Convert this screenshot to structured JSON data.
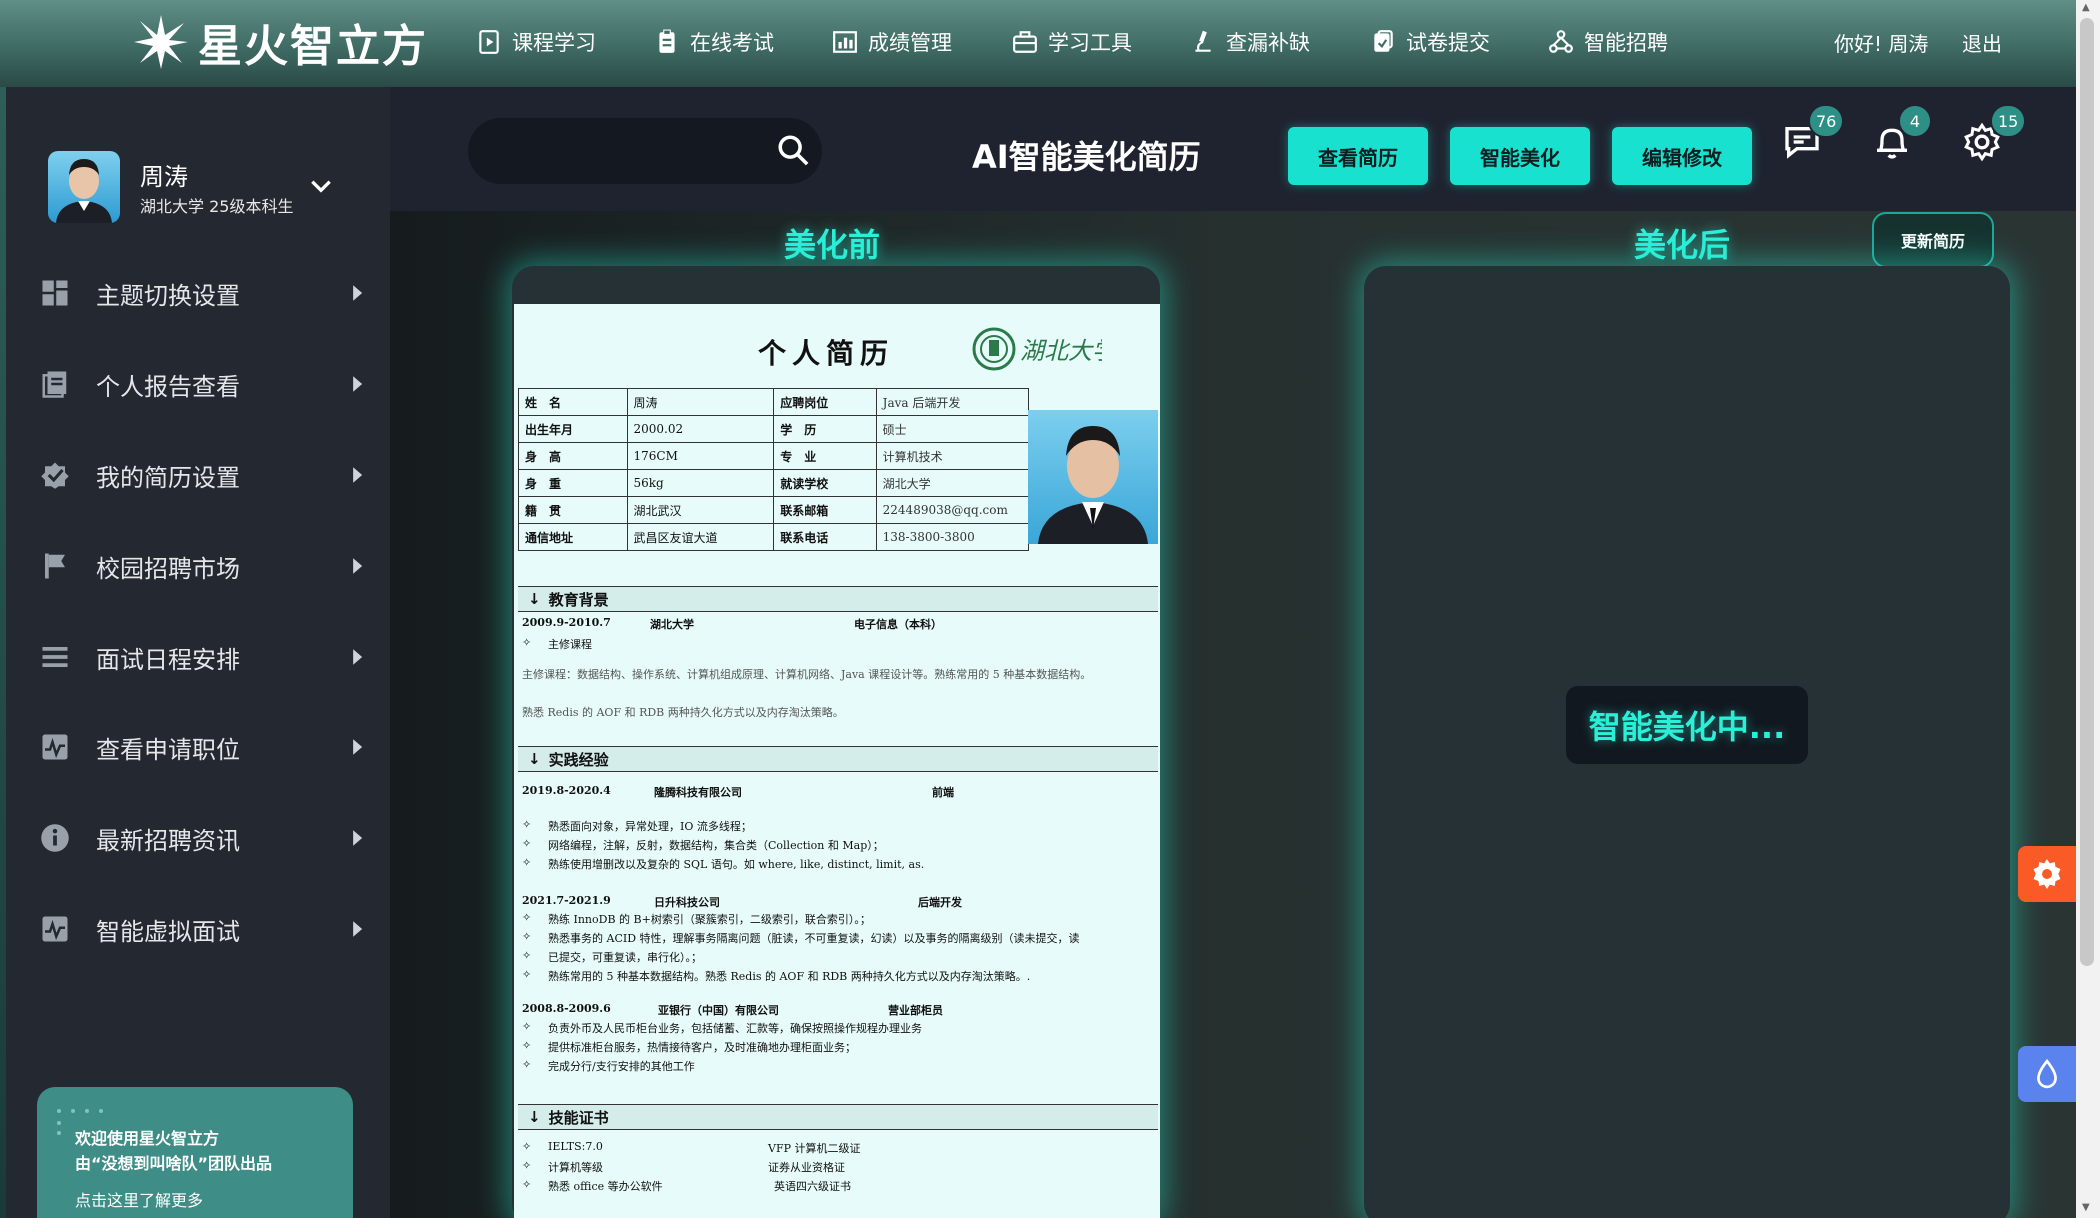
{
  "app": {
    "logo_text": "星火智立方"
  },
  "topnav": [
    {
      "label": "课程学习",
      "icon": "play-document-icon"
    },
    {
      "label": "在线考试",
      "icon": "clipboard-icon"
    },
    {
      "label": "成绩管理",
      "icon": "bar-chart-icon"
    },
    {
      "label": "学习工具",
      "icon": "toolbox-icon"
    },
    {
      "label": "查漏补缺",
      "icon": "microscope-icon"
    },
    {
      "label": "试卷提交",
      "icon": "submit-paper-icon"
    },
    {
      "label": "智能招聘",
      "icon": "network-icon"
    }
  ],
  "user_header": {
    "greeting": "你好! 周涛",
    "logout": "退出"
  },
  "profile": {
    "name": "周涛",
    "info": "湖北大学 25级本科生"
  },
  "sidebar": [
    {
      "label": "主题切换设置",
      "icon": "grid-icon"
    },
    {
      "label": "个人报告查看",
      "icon": "report-icon"
    },
    {
      "label": "我的简历设置",
      "icon": "check-badge-icon"
    },
    {
      "label": "校园招聘市场",
      "icon": "flag-icon"
    },
    {
      "label": "面试日程安排",
      "icon": "list-icon"
    },
    {
      "label": "查看申请职位",
      "icon": "pulse-icon"
    },
    {
      "label": "最新招聘资讯",
      "icon": "info-icon"
    },
    {
      "label": "智能虚拟面试",
      "icon": "pulse-icon"
    }
  ],
  "promo": {
    "line1": "欢迎使用星火智立方",
    "line2": "由“没想到叫啥队”团队出品",
    "line3": "点击这里了解更多"
  },
  "header": {
    "search_placeholder": "",
    "title": "AI智能美化简历",
    "buttons": {
      "view": "查看简历",
      "beautify": "智能美化",
      "edit": "编辑修改"
    },
    "badges": {
      "messages": "76",
      "notifications": "4",
      "settings": "15"
    }
  },
  "main": {
    "before_title": "美化前",
    "after_title": "美化后",
    "update_button": "更新简历",
    "loading_text": "智能美化中..."
  },
  "resume": {
    "title": "个人简历",
    "school_logo_text": "湖北大学",
    "info_rows": [
      {
        "k1": "姓　名",
        "v1": "周涛",
        "k2": "应聘岗位",
        "v2": "Java 后端开发"
      },
      {
        "k1": "出生年月",
        "v1": "2000.02",
        "k2": "学　历",
        "v2": "硕士"
      },
      {
        "k1": "身　高",
        "v1": "176CM",
        "k2": "专　业",
        "v2": "计算机技术"
      },
      {
        "k1": "身　重",
        "v1": "56kg",
        "k2": "就读学校",
        "v2": "湖北大学"
      },
      {
        "k1": "籍　贯",
        "v1": "湖北武汉",
        "k2": "联系邮箱",
        "v2": "224489038@qq.com"
      },
      {
        "k1": "通信地址",
        "v1": "武昌区友谊大道",
        "k2": "联系电话",
        "v2": "138-3800-3800"
      }
    ],
    "education": {
      "heading": "教育背景",
      "period": "2009.9-2010.7",
      "school": "湖北大学",
      "major": "电子信息（本科）",
      "courses_label": "主修课程",
      "courses": "主修课程：数据结构、操作系统、计算机组成原理、计算机网络、Java 课程设计等。熟练常用的 5 种基本数据结构。",
      "redis": "熟悉 Redis 的 AOF 和 RDB 两种持久化方式以及内存淘汰策略。"
    },
    "experience": {
      "heading": "实践经验",
      "jobs": [
        {
          "period": "2019.8-2020.4",
          "company": "隆腾科技有限公司",
          "role": "前端",
          "items": [
            "熟悉面向对象，异常处理，IO 流多线程；",
            "网络编程，注解，反射，数据结构，集合类（Collection 和 Map）；",
            "熟练使用增删改以及复杂的 SQL 语句。如 where, like, distinct, limit, as."
          ]
        },
        {
          "period": "2021.7-2021.9",
          "company": "日升科技公司",
          "role": "后端开发",
          "items": [
            "熟练 InnoDB 的 B+树索引（聚簇索引，二级索引，联合索引）。；",
            "熟悉事务的 ACID 特性，理解事务隔离问题（脏读，不可重复读，幻读）以及事务的隔离级别（读未提交，读",
            "已提交，可重复读，串行化）。；",
            "熟练常用的 5 种基本数据结构。熟悉 Redis 的 AOF 和 RDB 两种持久化方式以及内存淘汰策略。."
          ]
        },
        {
          "period": "2008.8-2009.6",
          "company": "亚银行（中国）有限公司",
          "role": "营业部柜员",
          "items": [
            "负责外币及人民币柜台业务，包括储蓄、汇款等，确保按照操作规程办理业务",
            "提供标准柜台服务，热情接待客户，及时准确地办理柜面业务；",
            "完成分行/支行安排的其他工作"
          ]
        }
      ]
    },
    "skills": {
      "heading": "技能证书",
      "left": [
        "IELTS:7.0",
        "计算机等级",
        "熟悉 office 等办公软件"
      ],
      "right": [
        "VFP 计算机二级证",
        "证券从业资格证",
        "英语四六级证书"
      ]
    }
  }
}
